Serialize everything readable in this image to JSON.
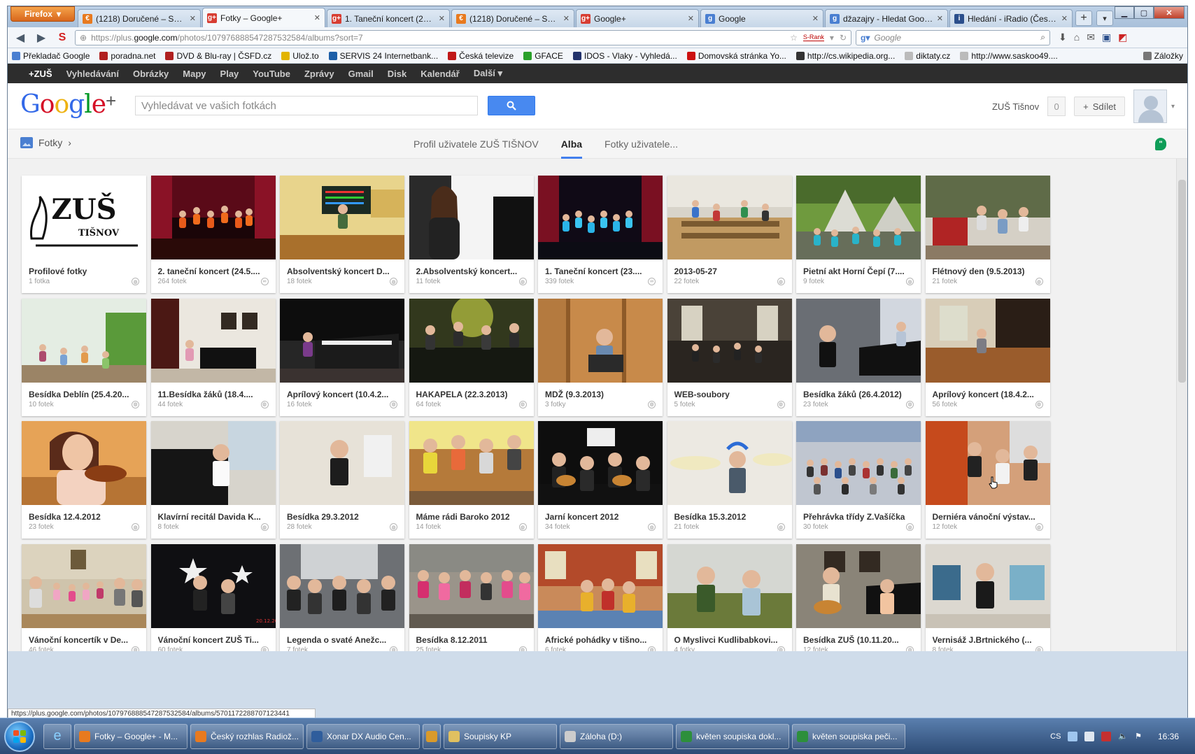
{
  "browser": {
    "menu_button": "Firefox",
    "tabs": [
      {
        "label": "(1218) Doručené – Sezn...",
        "fav": "#e87a1f",
        "glyph": "€"
      },
      {
        "label": "Fotky – Google+",
        "fav": "#d73d32",
        "glyph": "g+",
        "active": true
      },
      {
        "label": "1. Taneční koncert (23....",
        "fav": "#d73d32",
        "glyph": "g+"
      },
      {
        "label": "(1218) Doručené – Sezn...",
        "fav": "#e87a1f",
        "glyph": "€"
      },
      {
        "label": "Google+",
        "fav": "#d73d32",
        "glyph": "g+"
      },
      {
        "label": "Google",
        "fav": "#4a7fd1",
        "glyph": "g"
      },
      {
        "label": "džazajry - Hledat Goog...",
        "fav": "#4a7fd1",
        "glyph": "g"
      },
      {
        "label": "Hledání - iRadio (Česk...",
        "fav": "#2b4f8c",
        "glyph": "i"
      }
    ],
    "url": {
      "prefix": "https://plus.",
      "domain": "google.com",
      "path": "/photos/107976888547287532584/albums?sort=7"
    },
    "srank": "S-Rank",
    "search_placeholder": "Google",
    "bookmarks": [
      {
        "label": "Překladač Google",
        "color": "#4a7fd1"
      },
      {
        "label": "poradna.net",
        "color": "#b02020"
      },
      {
        "label": "DVD & Blu-ray | ČSFD.cz",
        "color": "#b02020"
      },
      {
        "label": "Ulož.to",
        "color": "#e2b400"
      },
      {
        "label": "SERVIS 24 Internetbank...",
        "color": "#1d5fa8"
      },
      {
        "label": "Česká televize",
        "color": "#c01818"
      },
      {
        "label": "GFACE",
        "color": "#2aa02a"
      },
      {
        "label": "IDOS - Vlaky - Vyhledá...",
        "color": "#22326b"
      },
      {
        "label": "Domovská stránka Yo...",
        "color": "#cc1111"
      },
      {
        "label": "http://cs.wikipedia.org...",
        "color": "#333333"
      },
      {
        "label": "diktaty.cz",
        "color": "#bbbbbb"
      },
      {
        "label": "http://www.saskoo49....",
        "color": "#bbbbbb"
      }
    ],
    "bookmarks_menu": "Záložky"
  },
  "gbar": {
    "items": [
      "+ZUŠ",
      "Vyhledávání",
      "Obrázky",
      "Mapy",
      "Play",
      "YouTube",
      "Zprávy",
      "Gmail",
      "Disk",
      "Kalendář",
      "Další ▾"
    ]
  },
  "header": {
    "logo": "Google+",
    "search_placeholder": "Vyhledávat ve vašich fotkách",
    "user_name": "ZUŠ Tišnov",
    "notif_count": "0",
    "share_label": "Sdílet"
  },
  "subnav": {
    "photos_label": "Fotky",
    "tabs": [
      "Profil uživatele ZUŠ TIŠNOV",
      "Alba",
      "Fotky uživatele..."
    ],
    "active_tab": "Alba"
  },
  "albums": [
    {
      "title": "Profilové fotky",
      "count": "1 fotka",
      "scene": "logo",
      "vis": "globe"
    },
    {
      "title": "2. taneční koncert (24.5....",
      "count": "264 fotek",
      "scene": "stage-red",
      "vis": "link"
    },
    {
      "title": "Absolventský koncert D...",
      "count": "18 fotek",
      "scene": "room-yellow",
      "vis": "globe"
    },
    {
      "title": "2.Absolventský koncert...",
      "count": "11 fotek",
      "scene": "portrait-white",
      "vis": "globe"
    },
    {
      "title": "1. Taneční koncert (23....",
      "count": "339 fotek",
      "scene": "stage-blue",
      "vis": "link"
    },
    {
      "title": "2013-05-27",
      "count": "22 fotek",
      "scene": "hall-chairs",
      "vis": "globe"
    },
    {
      "title": "Pietní akt Horní Čepí (7....",
      "count": "9 fotek",
      "scene": "outdoor-band",
      "vis": "globe"
    },
    {
      "title": "Flétnový den (9.5.2013)",
      "count": "21 fotek",
      "scene": "class-green",
      "vis": "globe"
    },
    {
      "title": "Besídka Deblín (25.4.20...",
      "count": "10 fotek",
      "scene": "room-light",
      "vis": "globe"
    },
    {
      "title": "11.Besídka žáků (18.4....",
      "count": "44 fotek",
      "scene": "piano-room",
      "vis": "globe"
    },
    {
      "title": "Aprílový koncert (10.4.2...",
      "count": "16 fotek",
      "scene": "piano-dark",
      "vis": "globe"
    },
    {
      "title": "HAKAPELA (22.3.2013)",
      "count": "64 fotek",
      "scene": "band-green",
      "vis": "globe"
    },
    {
      "title": "MDŽ (9.3.2013)",
      "count": "3 fotky",
      "scene": "wood",
      "vis": "globe"
    },
    {
      "title": "WEB-soubory",
      "count": "5 fotek",
      "scene": "hall-dark",
      "vis": "globe"
    },
    {
      "title": "Besídka žáků (26.4.2012)",
      "count": "23 fotek",
      "scene": "piano-people",
      "vis": "globe"
    },
    {
      "title": "Aprílový koncert (18.4.2...",
      "count": "56 fotek",
      "scene": "stage-wood",
      "vis": "globe"
    },
    {
      "title": "Besídka 12.4.2012",
      "count": "23 fotek",
      "scene": "violin",
      "vis": "globe"
    },
    {
      "title": "Klavírní recitál Davida K...",
      "count": "8 fotek",
      "scene": "piano-boy",
      "vis": "globe"
    },
    {
      "title": "Besídka 29.3.2012",
      "count": "28 fotek",
      "scene": "man-grey",
      "vis": "globe"
    },
    {
      "title": "Máme rádi Baroko 2012",
      "count": "14 fotek",
      "scene": "flutes",
      "vis": "globe"
    },
    {
      "title": "Jarní koncert 2012",
      "count": "34 fotek",
      "scene": "guitars-dark",
      "vis": "globe"
    },
    {
      "title": "Besídka 15.3.2012",
      "count": "21 fotek",
      "scene": "drums",
      "vis": "globe"
    },
    {
      "title": "Přehrávka třídy Z.Vašíčka",
      "count": "30 fotek",
      "scene": "audience",
      "vis": "globe"
    },
    {
      "title": "Derniéra vánoční výstav...",
      "count": "12 fotek",
      "scene": "exhibition",
      "vis": "globe"
    },
    {
      "title": "Vánoční koncertík v De...",
      "count": "46 fotek",
      "scene": "kids-room",
      "vis": "globe"
    },
    {
      "title": "Vánoční koncert ZUŠ Ti...",
      "count": "60 fotek",
      "scene": "stars",
      "vis": "globe"
    },
    {
      "title": "Legenda o svaté Anežc...",
      "count": "7 fotek",
      "scene": "crowd",
      "vis": "globe"
    },
    {
      "title": "Besídka 8.12.2011",
      "count": "25 fotek",
      "scene": "pink-kids",
      "vis": "globe"
    },
    {
      "title": "Africké pohádky v tišno...",
      "count": "6 fotek",
      "scene": "library",
      "vis": "globe"
    },
    {
      "title": "O Myslivci Kudlibabkovi...",
      "count": "4 fotky",
      "scene": "theatre",
      "vis": "globe"
    },
    {
      "title": "Besídka ZUŠ (10.11.20...",
      "count": "12 fotek",
      "scene": "guitar-man",
      "vis": "globe"
    },
    {
      "title": "Vernisáž J.Brtnického (...",
      "count": "8 fotek",
      "scene": "gallery",
      "vis": "globe"
    }
  ],
  "status_url": "https://plus.google.com/photos/107976888547287532584/albums/5701172288707123441",
  "taskbar": {
    "tasks": [
      {
        "label": "Fotky – Google+ - M...",
        "color": "#e87a1f"
      },
      {
        "label": "Český rozhlas Radiož...",
        "color": "#e87a1f"
      },
      {
        "label": "Xonar DX Audio Cen...",
        "color": "#2f5d9c"
      },
      {
        "label": "",
        "color": "#d99a2b",
        "small": true
      },
      {
        "label": "Soupisky KP",
        "color": "#e0c060"
      },
      {
        "label": "Záloha (D:)",
        "color": "#cccccc"
      },
      {
        "label": "květen soupiska dokl...",
        "color": "#2d8f3c"
      },
      {
        "label": "květen soupiska peči...",
        "color": "#2d8f3c"
      }
    ],
    "lang": "CS",
    "clock": "16:36"
  }
}
